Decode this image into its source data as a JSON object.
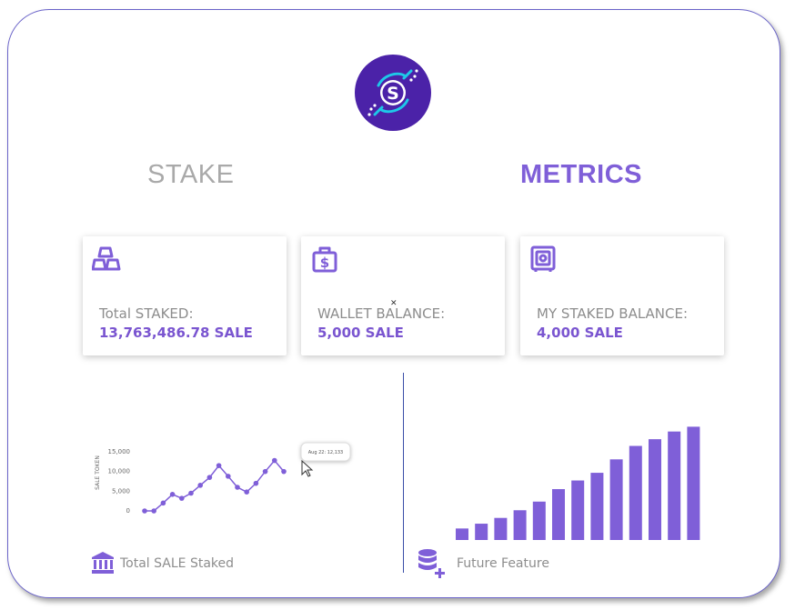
{
  "colors": {
    "accent": "#7f5fd8",
    "accent_dark": "#4b22a8",
    "logo_cyan": "#1ec8e8",
    "muted_text": "#8d8d8d",
    "divider": "#3a4ea8"
  },
  "logo": {
    "letter": "S",
    "icon": "circuit-s-logo-icon"
  },
  "tabs": [
    {
      "label": "STAKE",
      "active": false
    },
    {
      "label": "METRICS",
      "active": true
    }
  ],
  "cards": [
    {
      "icon": "gold-bars-icon",
      "label": "Total STAKED:",
      "value": "13,763,486.78 SALE"
    },
    {
      "icon": "money-bag-icon",
      "label": "WALLET BALANCE:",
      "value": "5,000 SALE"
    },
    {
      "icon": "safe-vault-icon",
      "label": "MY STAKED BALANCE:",
      "value": "4,000 SALE"
    }
  ],
  "chart_data": [
    {
      "type": "line",
      "ylabel": "SALE TOKEN",
      "y_ticks": [
        "15,000",
        "10,000",
        "5,000",
        "0"
      ],
      "ylim": [
        0,
        15000
      ],
      "values": [
        0,
        0,
        2000,
        4200,
        3200,
        4500,
        6500,
        8500,
        11500,
        8800,
        6000,
        4800,
        7000,
        10000,
        12800,
        10000
      ],
      "tooltip": "Aug 22: 12,133",
      "grid": false
    },
    {
      "type": "bar",
      "values": [
        12,
        17,
        23,
        31,
        40,
        53,
        62,
        70,
        84,
        98,
        105,
        113,
        118
      ],
      "ylim": [
        0,
        125
      ],
      "grid": false
    }
  ],
  "footer": {
    "left": {
      "icon": "bank-icon",
      "label": "Total SALE Staked"
    },
    "right": {
      "icon": "database-plus-icon",
      "label": "Future Feature"
    }
  }
}
